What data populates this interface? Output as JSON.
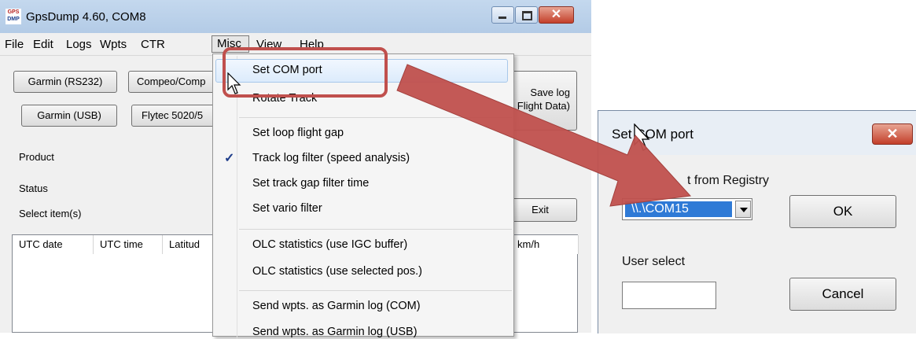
{
  "main_window": {
    "title": "GpsDump 4.60, COM8",
    "icon_text_top": "GPS",
    "icon_text_bottom": "DMP",
    "menus": [
      "File",
      "Edit",
      "Logs",
      "Wpts",
      "CTR",
      "Misc",
      "View",
      "Help"
    ],
    "buttons": {
      "garmin_rs232": "Garmin (RS232)",
      "compeo": "Compeo/Comp",
      "garmin_usb": "Garmin (USB)",
      "flytec": "Flytec 5020/5",
      "save_log_line1": "Save log",
      "save_log_line2": "Flight Data)",
      "exit": "Exit"
    },
    "labels": {
      "product": "Product",
      "status": "Status",
      "select_items": "Select item(s)"
    },
    "columns": [
      "UTC date",
      "UTC time",
      "Latitud",
      "km/h"
    ]
  },
  "misc_menu": {
    "items": [
      "Set COM port",
      "Rotate Track",
      "Set loop flight gap",
      "Track log filter (speed analysis)",
      "Set track gap filter time",
      "Set vario filter",
      "OLC statistics (use IGC buffer)",
      "OLC statistics (use selected pos.)",
      "Send wpts. as Garmin log (COM)",
      "Send wpts. as Garmin log (USB)"
    ],
    "checked_item": "Track log filter (speed analysis)",
    "highlighted_item": "Set COM port",
    "check_glyph": "✓"
  },
  "dialog": {
    "title": "Set COM port",
    "registry_label": "t from Registry",
    "combo_value": "\\\\.\\COM15",
    "ok": "OK",
    "user_select_label": "User select",
    "cancel": "Cancel",
    "close_glyph": "✕"
  },
  "colors": {
    "annotation_red": "#c0504d",
    "selection_blue": "#2f7ad6"
  }
}
